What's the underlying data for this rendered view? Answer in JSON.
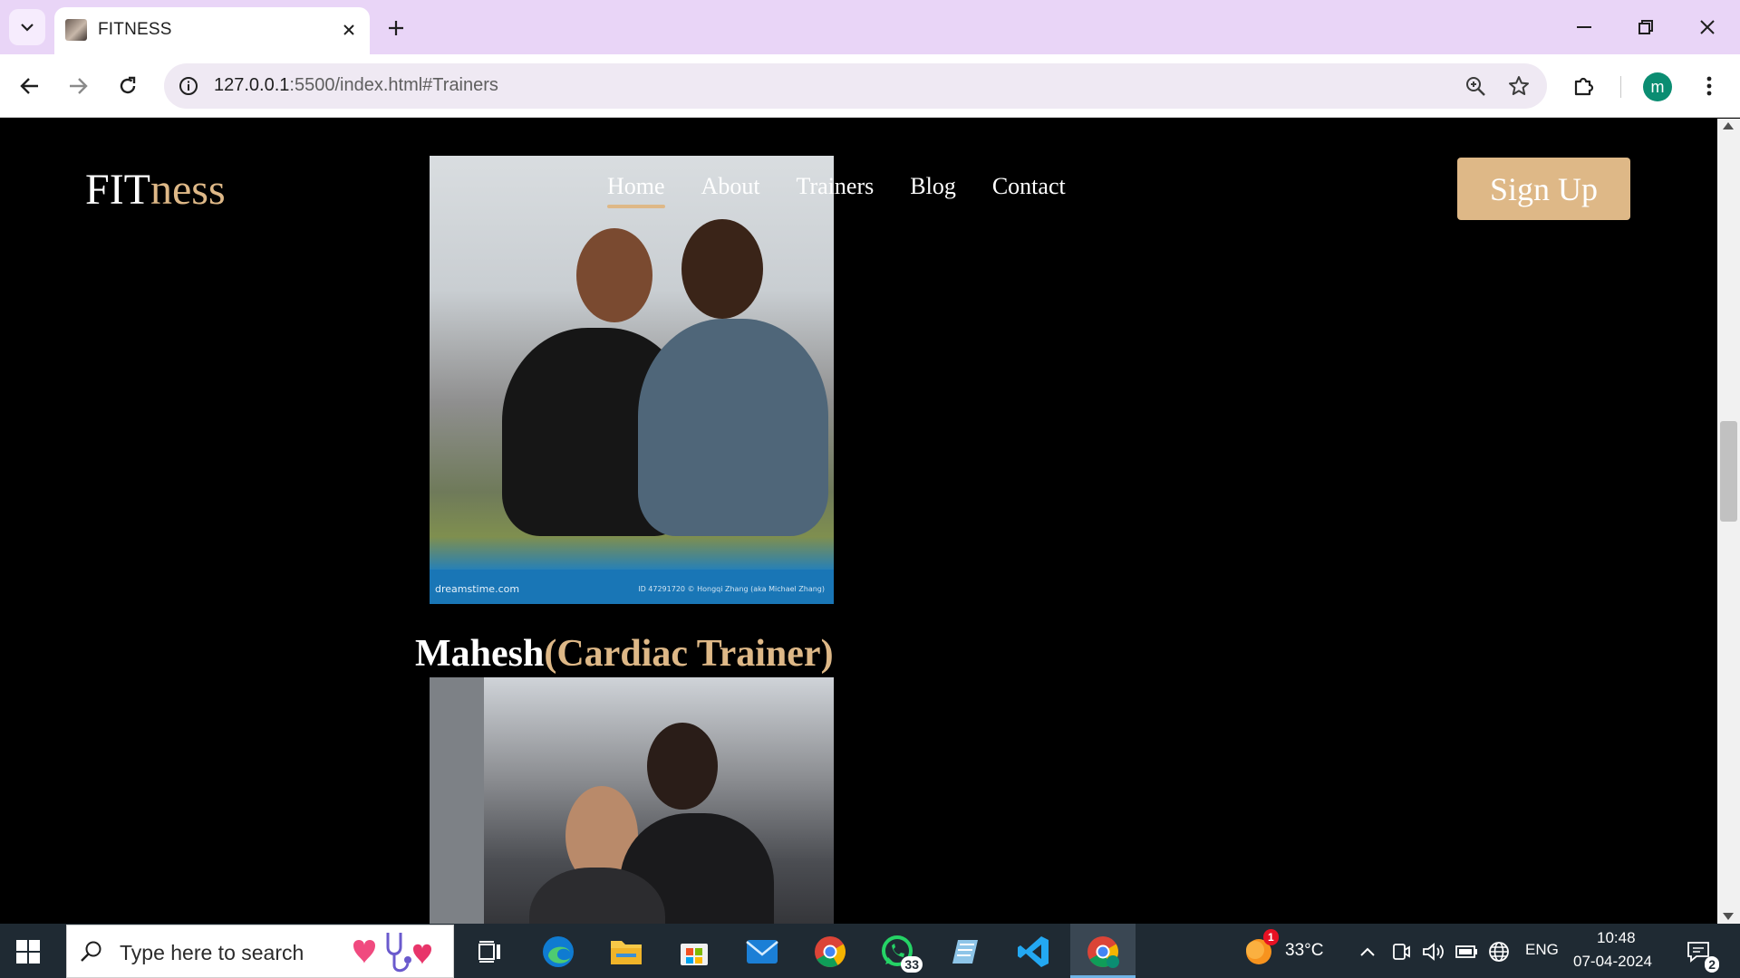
{
  "browser": {
    "tab_title": "FITNESS",
    "url_host": "127.0.0.1",
    "url_path": ":5500/index.html#Trainers",
    "profile_initial": "m"
  },
  "site": {
    "logo_main": "FIT",
    "logo_accent": "ness",
    "nav": [
      "Home",
      "About",
      "Trainers",
      "Blog",
      "Contact"
    ],
    "active_nav": "Home",
    "signup_label": "Sign Up",
    "accent_color": "#deb887"
  },
  "trainers": {
    "photo1_credit_left": "dreamstime.com",
    "photo1_credit_right": "ID 47291720 © Hongqi Zhang (aka Michael Zhang)",
    "name": "Mahesh",
    "role": "(Cardiac Trainer)"
  },
  "taskbar": {
    "search_placeholder": "Type here to search",
    "whatsapp_badge": "33",
    "weather_badge": "1",
    "temperature": "33°C",
    "language": "ENG",
    "time": "10:48",
    "date": "07-04-2024",
    "notifications_badge": "2"
  }
}
